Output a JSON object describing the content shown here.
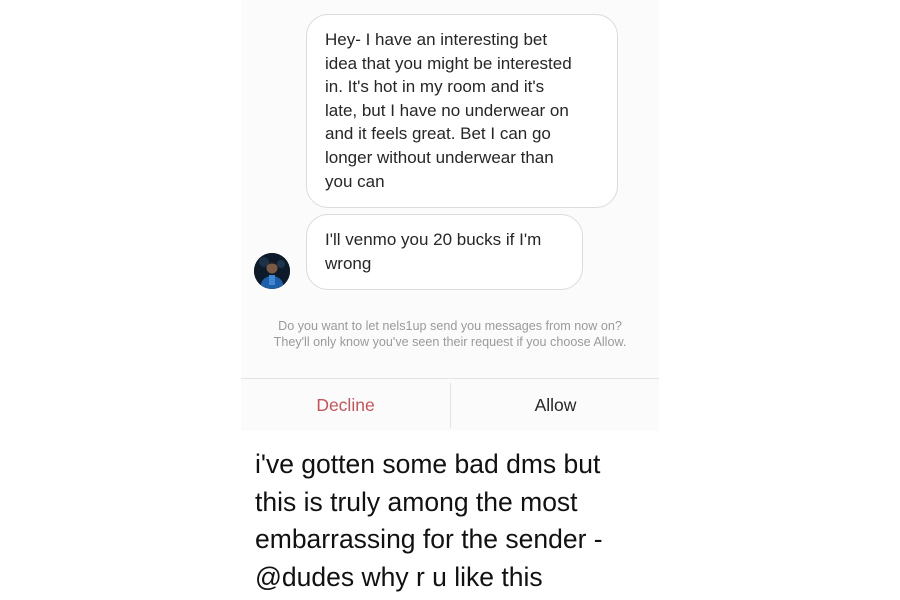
{
  "thread": {
    "messages": [
      {
        "lines": [
          "Hey- I have an interesting bet",
          "idea that you might be interested",
          "in. It's hot in my room and it's",
          "late, but I have no underwear on",
          "and it feels great. Bet I can go",
          "longer without underwear than",
          "you can"
        ]
      },
      {
        "lines": [
          "I'll venmo you 20 bucks if I'm",
          "wrong"
        ]
      }
    ],
    "avatar_icon": "user-avatar-icon"
  },
  "request": {
    "line1": "Do you want to let nels1up send you messages from now on?",
    "line2": "They'll only know you've seen their request if you choose Allow."
  },
  "actions": {
    "decline_label": "Decline",
    "allow_label": "Allow",
    "decline_color": "#c0555e"
  },
  "caption": {
    "lines": [
      "i've gotten some bad dms but",
      "this is truly among the most",
      "embarrassing for the sender -",
      "@dudes why r u like this"
    ]
  }
}
